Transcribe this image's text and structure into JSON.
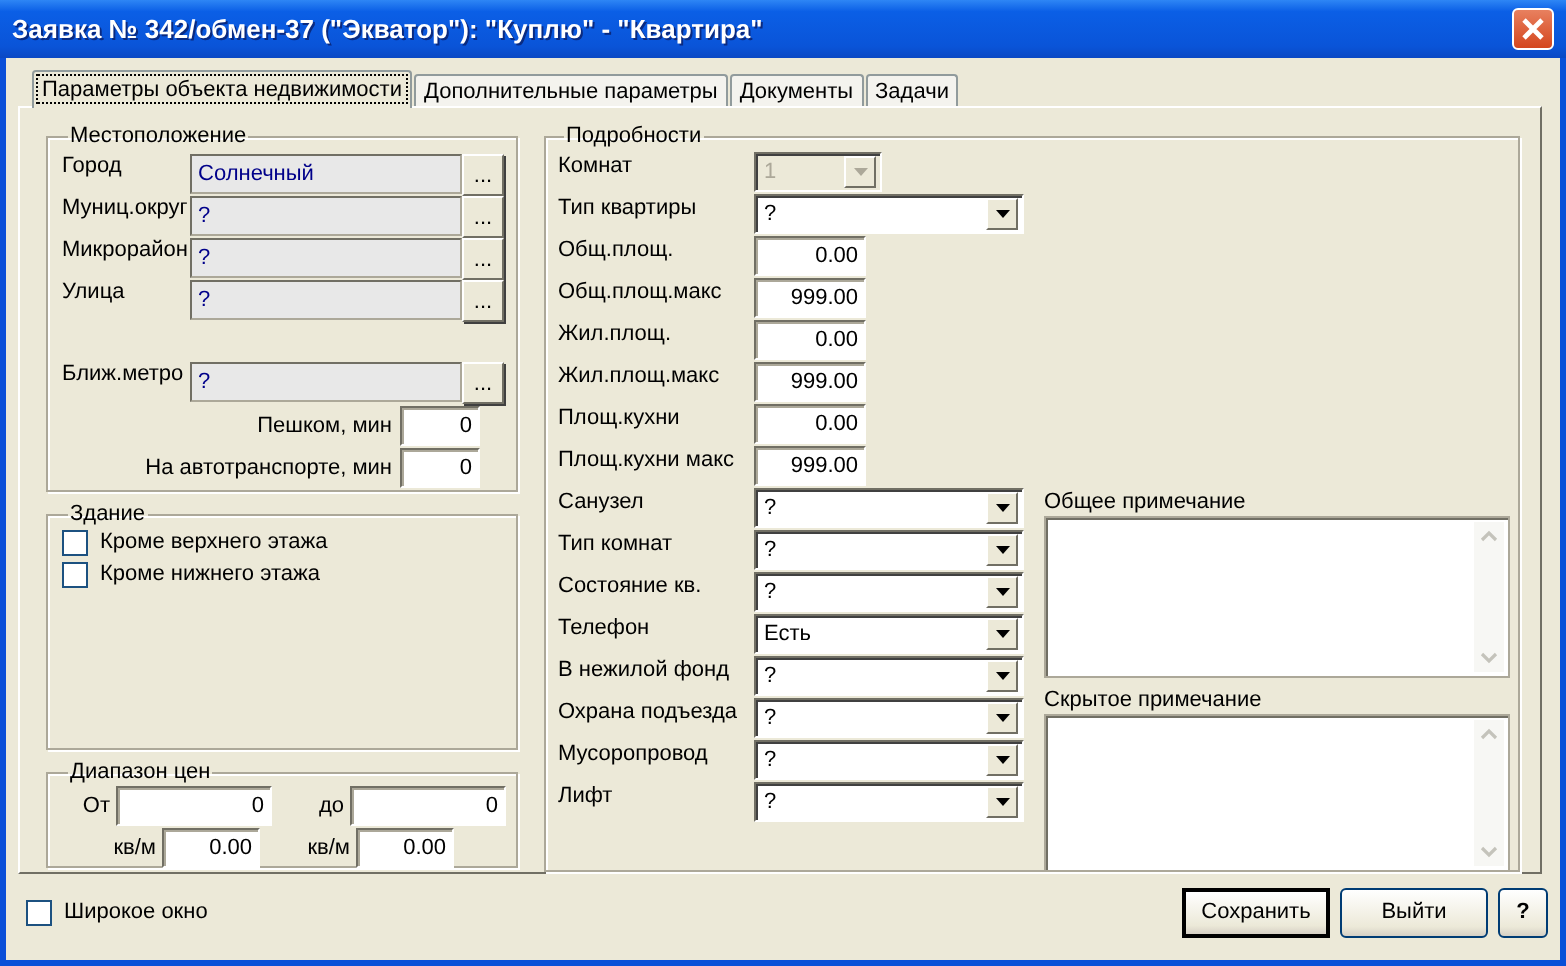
{
  "window": {
    "title": "Заявка № 342/обмен-37 (\"Экватор\"): \"Куплю\" - \"Квартира\""
  },
  "tabs": [
    {
      "label": "Параметры объекта недвижимости",
      "selected": true
    },
    {
      "label": "Дополнительные параметры",
      "selected": false
    },
    {
      "label": "Документы",
      "selected": false
    },
    {
      "label": "Задачи",
      "selected": false
    }
  ],
  "location": {
    "legend": "Местоположение",
    "fields": [
      {
        "label": "Город",
        "value": "Солнечный",
        "button": "..."
      },
      {
        "label": "Муниц.округ",
        "value": "?",
        "button": "..."
      },
      {
        "label": "Микрорайон",
        "value": "?",
        "button": "..."
      },
      {
        "label": "Улица",
        "value": "?",
        "button": "..."
      }
    ],
    "metro": {
      "label": "Ближ.метро",
      "value": "?",
      "button": "..."
    },
    "times": [
      {
        "label": "Пешком, мин",
        "value": "0"
      },
      {
        "label": "На автотранспорте, мин",
        "value": "0"
      }
    ]
  },
  "building": {
    "legend": "Здание",
    "checkboxes": [
      {
        "label": "Кроме верхнего этажа",
        "checked": false
      },
      {
        "label": "Кроме нижнего этажа",
        "checked": false
      }
    ]
  },
  "prices": {
    "legend": "Диапазон цен",
    "rows": [
      {
        "label_1": "От",
        "value_1": "0",
        "label_2": "до",
        "value_2": "0"
      },
      {
        "label_1": "кв/м",
        "value_1": "0.00",
        "label_2": "кв/м",
        "value_2": "0.00"
      }
    ]
  },
  "details": {
    "legend": "Подробности",
    "rows": [
      {
        "kind": "combo",
        "label": "Комнат",
        "value": "1",
        "disabled": true
      },
      {
        "kind": "combo",
        "label": "Тип квартиры",
        "value": "?",
        "disabled": false
      },
      {
        "kind": "number",
        "label": "Общ.площ.",
        "value": "0.00"
      },
      {
        "kind": "number",
        "label": "Общ.площ.макс",
        "value": "999.00"
      },
      {
        "kind": "number",
        "label": "Жил.площ.",
        "value": "0.00"
      },
      {
        "kind": "number",
        "label": "Жил.площ.макс",
        "value": "999.00"
      },
      {
        "kind": "number",
        "label": "Площ.кухни",
        "value": "0.00"
      },
      {
        "kind": "number",
        "label": "Площ.кухни макс",
        "value": "999.00"
      },
      {
        "kind": "combo",
        "label": "Санузел",
        "value": "?",
        "disabled": false
      },
      {
        "kind": "combo",
        "label": "Тип комнат",
        "value": "?",
        "disabled": false
      },
      {
        "kind": "combo",
        "label": "Состояние кв.",
        "value": "?",
        "disabled": false
      },
      {
        "kind": "combo",
        "label": "Телефон",
        "value": "Есть",
        "disabled": false
      },
      {
        "kind": "combo",
        "label": "В нежилой фонд",
        "value": "?",
        "disabled": false
      },
      {
        "kind": "combo",
        "label": "Охрана подъезда",
        "value": "?",
        "disabled": false
      },
      {
        "kind": "combo",
        "label": "Мусоропровод",
        "value": "?",
        "disabled": false
      },
      {
        "kind": "combo",
        "label": "Лифт",
        "value": "?",
        "disabled": false
      }
    ],
    "notes": [
      {
        "label": "Общее примечание"
      },
      {
        "label": "Скрытое примечание"
      }
    ]
  },
  "wide_window": {
    "label": "Широкое окно",
    "checked": false
  },
  "buttons": [
    {
      "label": "Сохранить",
      "default": true
    },
    {
      "label": "Выйти",
      "default": false
    },
    {
      "label": "?",
      "default": false
    }
  ]
}
